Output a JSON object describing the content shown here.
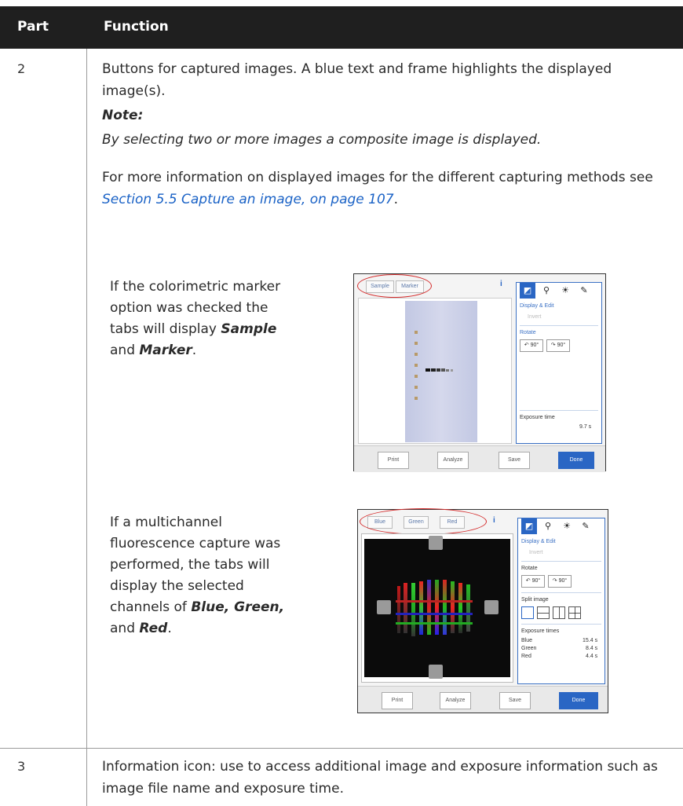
{
  "table": {
    "header": {
      "part": "Part",
      "function": "Function"
    }
  },
  "row2": {
    "part": "2",
    "desc": "Buttons for captured images. A blue text and frame highlights the displayed image(s).",
    "note_heading": "Note:",
    "note_body": "By selecting two or more images a composite image is displayed.",
    "more_info_pre": "For more information on displayed images for the different capturing methods see ",
    "more_info_link": "Section 5.5 Capture an image, on page 107",
    "more_info_post": ".",
    "case1": {
      "pre": "If the colorimetric marker option was checked the tabs will display ",
      "em1": "Sample",
      "mid": " and ",
      "em2": "Marker",
      "post": "."
    },
    "case2": {
      "pre": "If a multichannel fluorescence capture was performed, the tabs will display the selected channels of ",
      "em1": "Blue, Green,",
      "mid": " and ",
      "em2": "Red",
      "post": "."
    }
  },
  "row3": {
    "part": "3",
    "desc": "Information icon: use to access additional image and exposure information such as image file name and exposure time."
  },
  "screenshot1": {
    "tabs": [
      "Sample",
      "Marker"
    ],
    "info_icon": "i",
    "panel_title": "Display & Edit",
    "invert_label": "Invert",
    "rotate_label": "Rotate",
    "rotate_left": "90°",
    "rotate_right": "90°",
    "exposure_label": "Exposure time",
    "exposure_value": "9.7 s",
    "footer_buttons": [
      "Print",
      "Analyze",
      "Save",
      "Done"
    ],
    "icons": [
      "edit-icon",
      "zoom-icon",
      "brightness-icon",
      "pen-icon"
    ],
    "accent_color": "#2a66c4",
    "highlight_color": "#d42b2b"
  },
  "screenshot2": {
    "tabs": [
      "Blue",
      "Green",
      "Red"
    ],
    "info_icon": "i",
    "panel_title": "Display & Edit",
    "invert_label": "Invert",
    "rotate_label": "Rotate",
    "rotate_left": "90°",
    "rotate_right": "90°",
    "split_label": "Split image",
    "exposure_label": "Exposure times",
    "exposures": [
      {
        "channel": "Blue",
        "value": "15.4 s"
      },
      {
        "channel": "Green",
        "value": "8.4 s"
      },
      {
        "channel": "Red",
        "value": "4.4 s"
      }
    ],
    "footer_buttons": [
      "Print",
      "Analyze",
      "Save",
      "Done"
    ],
    "icons": [
      "edit-icon",
      "zoom-icon",
      "brightness-icon",
      "pen-icon"
    ],
    "accent_color": "#2a66c4",
    "highlight_color": "#d42b2b"
  }
}
